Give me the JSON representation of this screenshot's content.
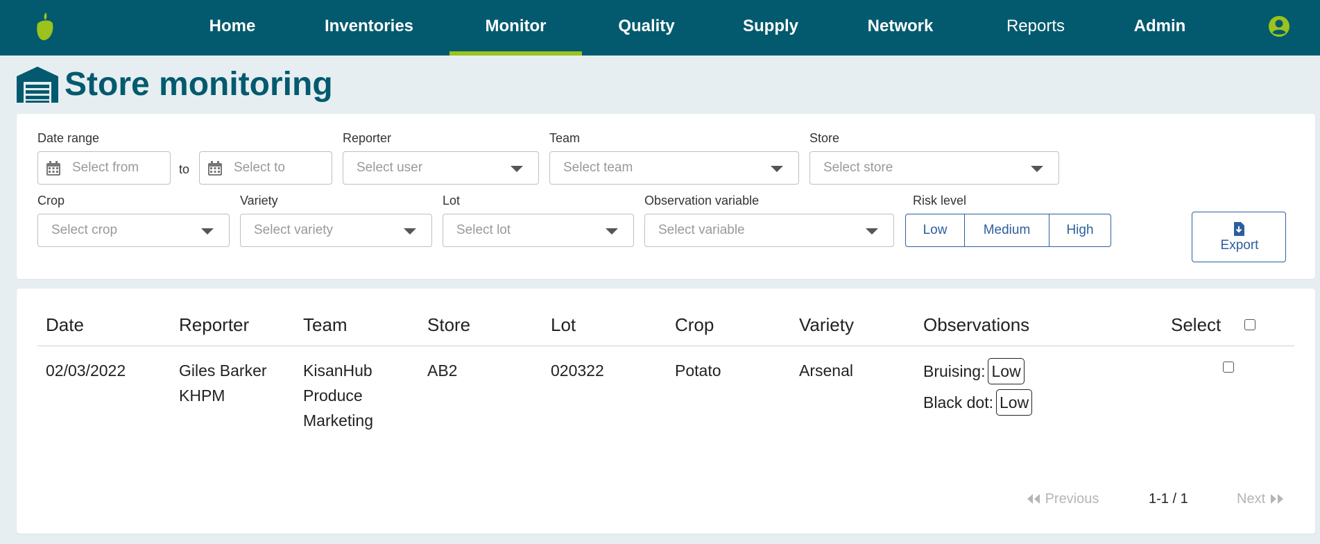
{
  "nav": {
    "items": [
      {
        "label": "Home"
      },
      {
        "label": "Inventories"
      },
      {
        "label": "Monitor"
      },
      {
        "label": "Quality"
      },
      {
        "label": "Supply"
      },
      {
        "label": "Network"
      },
      {
        "label": "Reports"
      },
      {
        "label": "Admin"
      }
    ],
    "active": "Monitor"
  },
  "page": {
    "title": "Store monitoring"
  },
  "filters": {
    "date_range_label": "Date range",
    "date_from_placeholder": "Select from",
    "to_label": "to",
    "date_to_placeholder": "Select to",
    "reporter_label": "Reporter",
    "reporter_placeholder": "Select user",
    "team_label": "Team",
    "team_placeholder": "Select team",
    "store_label": "Store",
    "store_placeholder": "Select store",
    "crop_label": "Crop",
    "crop_placeholder": "Select crop",
    "variety_label": "Variety",
    "variety_placeholder": "Select variety",
    "lot_label": "Lot",
    "lot_placeholder": "Select lot",
    "variable_label": "Observation variable",
    "variable_placeholder": "Select variable",
    "risk_label": "Risk level",
    "risk_options": [
      "Low",
      "Medium",
      "High"
    ],
    "export_label": "Export"
  },
  "table": {
    "columns": [
      "Date",
      "Reporter",
      "Team",
      "Store",
      "Lot",
      "Crop",
      "Variety",
      "Observations",
      "Select"
    ],
    "rows": [
      {
        "date": "02/03/2022",
        "reporter": [
          "Giles Barker",
          "KHPM"
        ],
        "team": [
          "KisanHub",
          "Produce",
          "Marketing"
        ],
        "store": "AB2",
        "lot": "020322",
        "crop": "Potato",
        "variety": "Arsenal",
        "observations": [
          {
            "name": "Bruising:",
            "level": "Low"
          },
          {
            "name": "Black dot:",
            "level": "Low"
          }
        ]
      }
    ]
  },
  "pagination": {
    "previous_label": "Previous",
    "range": "1-1 / 1",
    "next_label": "Next"
  },
  "colors": {
    "nav_bg": "#035a6e",
    "accent": "#9bc31c",
    "button_blue": "#2b5f9e",
    "page_bg": "#e6eef1"
  },
  "icons": [
    "app-logo-icon",
    "user-avatar-icon",
    "warehouse-icon",
    "calendar-icon",
    "chevron-down-icon",
    "export-download-icon",
    "double-chevron-left-icon",
    "double-chevron-right-icon"
  ]
}
